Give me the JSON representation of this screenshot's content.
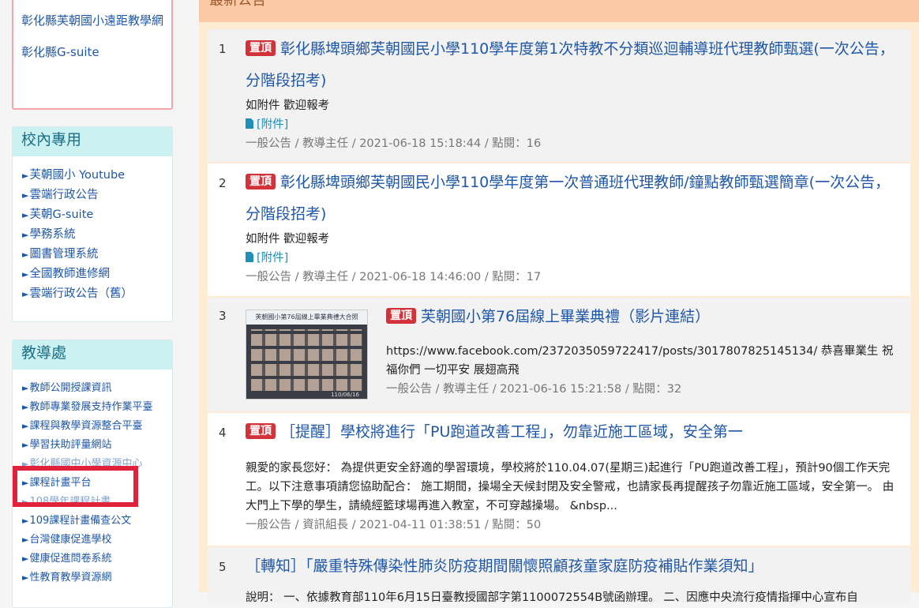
{
  "sidebar": {
    "top_links": [
      "彰化縣芙朝國小遠距教學網",
      "彰化縣G-suite"
    ],
    "campus": {
      "title": "校內專用",
      "items": [
        "芙朝國小 Youtube",
        "雲端行政公告",
        "芙朝G-suite",
        "學務系統",
        "圖書管理系統",
        "全國教師進修網",
        "雲端行政公告（舊）"
      ]
    },
    "academic": {
      "title": "教導處",
      "items": [
        "教師公開授課資訊",
        "教師專業發展支持作業平臺",
        "課程與教學資源整合平臺",
        "學習扶助評量網站",
        "彰化縣國中小學資源中心",
        "課程計畫平台",
        "108學年課程計畫",
        "109課程計畫備查公文",
        "台灣健康促進學校",
        "健康促進問卷系統",
        "性教育教學資源網"
      ]
    },
    "arrow": "►"
  },
  "main": {
    "header": "最新公告",
    "announcements": [
      {
        "num": "1",
        "tag": "置頂",
        "title": "彰化縣埤頭鄉芙朝國民小學110學年度第1次特教不分類巡迴輔導班代理教師甄選(一次公告，分階段招考)",
        "desc": "如附件 歡迎報考",
        "attach": "[附件]",
        "meta": "一般公告 / 教導主任 / 2021-06-18 15:18:44 / 點閱：16"
      },
      {
        "num": "2",
        "tag": "置頂",
        "title": "彰化縣埤頭鄉芙朝國民小學110學年度第一次普通班代理教師/鐘點教師甄選簡章(一次公告，分階段招考)",
        "desc": "如附件 歡迎報考",
        "attach": "[附件]",
        "meta": "一般公告 / 教導主任 / 2021-06-18 14:46:00 / 點閱：17"
      },
      {
        "num": "3",
        "tag": "置頂",
        "title": "芙朝國小第76屆線上畢業典禮（影片連結）",
        "desc": "https://www.facebook.com/2372035059722417/posts/3017807825145134/ 恭喜畢業生 祝福你們 一切平安 展翅高飛",
        "meta": "一般公告 / 教導主任 / 2021-06-16 15:21:58 / 點閱：32",
        "thumb_caption": "芙朝國小第76屆線上畢業典禮大合照",
        "thumb_date": "110/06/16"
      },
      {
        "num": "4",
        "tag": "置頂",
        "title": "［提醒］學校將進行「PU跑道改善工程」，勿靠近施工區域，安全第一",
        "desc": "親愛的家長您好： 為提供更安全舒適的學習環境，學校將於110.04.07(星期三)起進行「PU跑道改善工程」，預計90個工作天完工。以下注意事項請您協助配合： 施工期間，操場全天候封閉及安全警戒，也請家長再提醒孩子勿靠近施工區域，安全第一。 由大門上下學的學生，請繞經籃球場再進入教室，不可穿越操場。 &nbsp...",
        "meta": "一般公告 / 資訊組長 / 2021-04-11 01:38:51 / 點閱：50"
      },
      {
        "num": "5",
        "title": "［轉知］「嚴重特殊傳染性肺炎防疫期間關懷照顧孩童家庭防疫補貼作業須知」",
        "desc": "說明： 一、依據教育部110年6月15日臺教授國部字第1100072554B號函辦理。 二、因應中央流行疫情指揮中心宣布自"
      }
    ]
  }
}
